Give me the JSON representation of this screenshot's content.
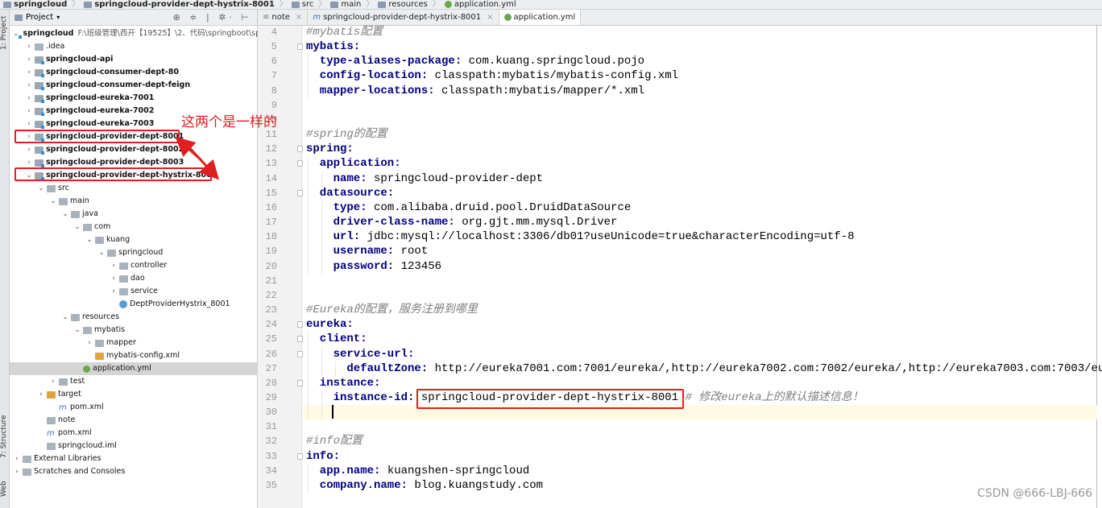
{
  "breadcrumb": [
    "springcloud",
    "springcloud-provider-dept-hystrix-8001",
    "src",
    "main",
    "resources",
    "application.yml"
  ],
  "tool_strip": {
    "project": "1: Project",
    "structure": "7: Structure",
    "web": "Web"
  },
  "project_panel": {
    "title": "Project",
    "dropdown_icon": "chevron-down-icon",
    "tools": "⊕ ≑ | ✲· ⊢"
  },
  "tree": [
    {
      "label": "springcloud",
      "path": "F:\\班级管理\\西开【19525】\\2、代码\\springboot\\sp",
      "level": 0,
      "arrow": "v",
      "icon": "mod",
      "bold": true
    },
    {
      "label": ".idea",
      "level": 1,
      "arrow": ">",
      "icon": "dir"
    },
    {
      "label": "springcloud-api",
      "level": 1,
      "arrow": ">",
      "icon": "mod",
      "bold": true
    },
    {
      "label": "springcloud-consumer-dept-80",
      "level": 1,
      "arrow": ">",
      "icon": "mod",
      "bold": true
    },
    {
      "label": "springcloud-consumer-dept-feign",
      "level": 1,
      "arrow": ">",
      "icon": "mod",
      "bold": true
    },
    {
      "label": "springcloud-eureka-7001",
      "level": 1,
      "arrow": ">",
      "icon": "mod",
      "bold": true
    },
    {
      "label": "springcloud-eureka-7002",
      "level": 1,
      "arrow": ">",
      "icon": "mod",
      "bold": true
    },
    {
      "label": "springcloud-eureka-7003",
      "level": 1,
      "arrow": ">",
      "icon": "mod",
      "bold": true
    },
    {
      "label": "springcloud-provider-dept-8001",
      "level": 1,
      "arrow": ">",
      "icon": "mod",
      "bold": true
    },
    {
      "label": "springcloud-provider-dept-8002",
      "level": 1,
      "arrow": ">",
      "icon": "mod",
      "bold": true
    },
    {
      "label": "springcloud-provider-dept-8003",
      "level": 1,
      "arrow": ">",
      "icon": "mod",
      "bold": true
    },
    {
      "label": "springcloud-provider-dept-hystrix-8001",
      "level": 1,
      "arrow": "v",
      "icon": "mod",
      "bold": true
    },
    {
      "label": "src",
      "level": 2,
      "arrow": "v",
      "icon": "dir"
    },
    {
      "label": "main",
      "level": 3,
      "arrow": "v",
      "icon": "dir"
    },
    {
      "label": "java",
      "level": 4,
      "arrow": "v",
      "icon": "dir"
    },
    {
      "label": "com",
      "level": 5,
      "arrow": "v",
      "icon": "dir"
    },
    {
      "label": "kuang",
      "level": 6,
      "arrow": "v",
      "icon": "dir"
    },
    {
      "label": "springcloud",
      "level": 7,
      "arrow": "v",
      "icon": "dir"
    },
    {
      "label": "controller",
      "level": 8,
      "arrow": ">",
      "icon": "dir"
    },
    {
      "label": "dao",
      "level": 8,
      "arrow": ">",
      "icon": "dir"
    },
    {
      "label": "service",
      "level": 8,
      "arrow": ">",
      "icon": "dir"
    },
    {
      "label": "DeptProviderHystrix_8001",
      "level": 8,
      "arrow": "",
      "icon": "cls"
    },
    {
      "label": "resources",
      "level": 4,
      "arrow": "v",
      "icon": "dir"
    },
    {
      "label": "mybatis",
      "level": 5,
      "arrow": "v",
      "icon": "dir"
    },
    {
      "label": "mapper",
      "level": 6,
      "arrow": ">",
      "icon": "dir"
    },
    {
      "label": "mybatis-config.xml",
      "level": 6,
      "arrow": "",
      "icon": "org"
    },
    {
      "label": "application.yml",
      "level": 5,
      "arrow": "",
      "icon": "yml",
      "selected": true
    },
    {
      "label": "test",
      "level": 3,
      "arrow": ">",
      "icon": "dir"
    },
    {
      "label": "target",
      "level": 2,
      "arrow": ">",
      "icon": "org"
    },
    {
      "label": "pom.xml",
      "level": 3,
      "arrow": "",
      "icon": "file"
    },
    {
      "label": "note",
      "level": 2,
      "arrow": "",
      "icon": "dir"
    },
    {
      "label": "pom.xml",
      "level": 2,
      "arrow": "",
      "icon": "file"
    },
    {
      "label": "springcloud.iml",
      "level": 2,
      "arrow": "",
      "icon": "dir"
    },
    {
      "label": "External Libraries",
      "level": 0,
      "arrow": ">",
      "icon": "dir"
    },
    {
      "label": "Scratches and Consoles",
      "level": 0,
      "arrow": ">",
      "icon": "dir"
    }
  ],
  "tabs": [
    {
      "label": "note",
      "icon": "text-file-icon"
    },
    {
      "label": "springcloud-provider-dept-hystrix-8001",
      "icon": "maven-icon"
    },
    {
      "label": "application.yml",
      "icon": "spring-leaf-icon",
      "active": true
    }
  ],
  "code": [
    {
      "n": 4,
      "i": 0,
      "c": "#mybatis配置"
    },
    {
      "n": 5,
      "i": 0,
      "k": "mybatis:"
    },
    {
      "n": 6,
      "i": 1,
      "k": "type-aliases-package:",
      "v": " com.kuang.springcloud.pojo"
    },
    {
      "n": 7,
      "i": 1,
      "k": "config-location:",
      "v": " classpath:mybatis/mybatis-config.xml"
    },
    {
      "n": 8,
      "i": 1,
      "k": "mapper-locations:",
      "v": " classpath:mybatis/mapper/*.xml"
    },
    {
      "n": 9,
      "i": 0
    },
    {
      "n": 10,
      "i": 0
    },
    {
      "n": 11,
      "i": 0,
      "c": "#spring的配置"
    },
    {
      "n": 12,
      "i": 0,
      "k": "spring:"
    },
    {
      "n": 13,
      "i": 1,
      "k": "application:"
    },
    {
      "n": 14,
      "i": 2,
      "k": "name:",
      "v": " springcloud-provider-dept"
    },
    {
      "n": 15,
      "i": 1,
      "k": "datasource:"
    },
    {
      "n": 16,
      "i": 2,
      "k": "type:",
      "v": " com.alibaba.druid.pool.DruidDataSource"
    },
    {
      "n": 17,
      "i": 2,
      "k": "driver-class-name:",
      "v": " org.gjt.mm.mysql.Driver"
    },
    {
      "n": 18,
      "i": 2,
      "k": "url:",
      "v": " jdbc:mysql://localhost:3306/db01?useUnicode=true&characterEncoding=utf-8"
    },
    {
      "n": 19,
      "i": 2,
      "k": "username:",
      "v": " root"
    },
    {
      "n": 20,
      "i": 2,
      "k": "password:",
      "v": " 123456"
    },
    {
      "n": 21,
      "i": 0
    },
    {
      "n": 22,
      "i": 0
    },
    {
      "n": 23,
      "i": 0,
      "c": "#Eureka的配置，服务注册到哪里"
    },
    {
      "n": 24,
      "i": 0,
      "k": "eureka:"
    },
    {
      "n": 25,
      "i": 1,
      "k": "client:"
    },
    {
      "n": 26,
      "i": 2,
      "k": "service-url:"
    },
    {
      "n": 27,
      "i": 3,
      "k": "defaultZone:",
      "v": " http://eureka7001.com:7001/eureka/,http://eureka7002.com:7002/eureka/,http://eureka7003.com:7003/eu"
    },
    {
      "n": 28,
      "i": 1,
      "k": "instance:"
    },
    {
      "n": 29,
      "i": 2,
      "k": "instance-id:",
      "v": " springcloud-provider-dept-hystrix-8001",
      "c": " # 修改eureka上的默认描述信息！"
    },
    {
      "n": 30,
      "i": 2,
      "current": true
    },
    {
      "n": 31,
      "i": 0
    },
    {
      "n": 32,
      "i": 0,
      "c": "#info配置"
    },
    {
      "n": 33,
      "i": 0,
      "k": "info:"
    },
    {
      "n": 34,
      "i": 1,
      "k": "app.name:",
      "v": " kuangshen-springcloud"
    },
    {
      "n": 35,
      "i": 1,
      "k": "company.name:",
      "v": " blog.kuangstudy.com"
    }
  ],
  "annotation": "这两个是一样的",
  "watermark": "CSDN @666-LBJ-666",
  "colors": {
    "annotation": "#e02020",
    "yaml_key": "#000080",
    "comment": "#808080",
    "current_line": "#fffae3"
  }
}
